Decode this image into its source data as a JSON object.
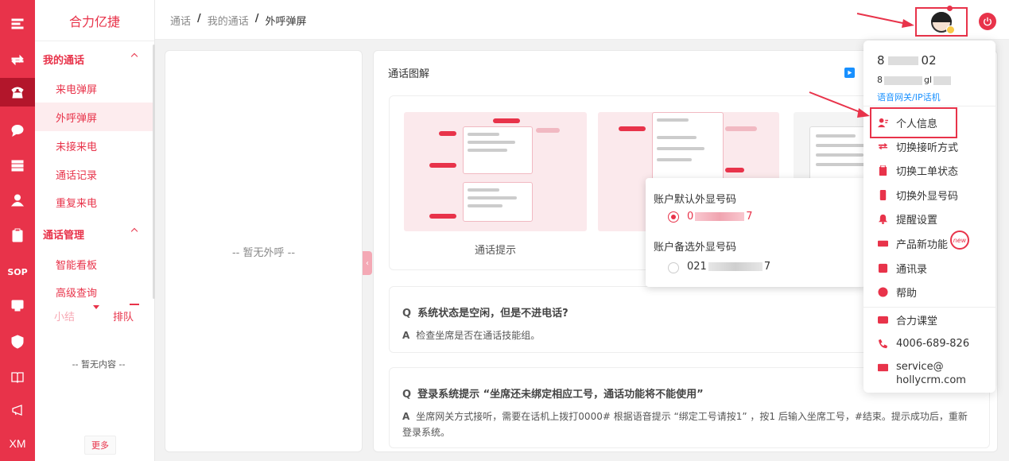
{
  "brand": "合力亿捷",
  "nav": {
    "group1": "我的通话",
    "items1": [
      "来电弹屏",
      "外呼弹屏",
      "未接来电",
      "通话记录",
      "重复来电"
    ],
    "group2": "通话管理",
    "items2": [
      "智能看板",
      "高级查询"
    ],
    "subtabs": [
      "小结",
      "排队"
    ],
    "empty": "-- 暂无内容 --",
    "more": "更多"
  },
  "rail": {
    "sop": "SOP",
    "xm": "XM"
  },
  "breadcrumb": [
    "通话",
    "我的通话",
    "外呼弹屏"
  ],
  "breadcrumb_sep": "/",
  "left_panel": {
    "empty": "-- 暂无外呼 --"
  },
  "main": {
    "title": "通话图解",
    "thumb_caption": "通话提示",
    "faq1": {
      "q_label": "Q",
      "q": "系统状态是空闲，但是不进电话?",
      "a_label": "A",
      "a": "检查坐席是否在通话技能组。"
    },
    "faq2": {
      "q_label": "Q",
      "q": "登录系统提示 “坐席还未绑定相应工号，通话功能将不能使用”",
      "a_label": "A",
      "a": "坐席网关方式接听，需要在话机上拨打0000# 根据语音提示 “绑定工号请按1” ，按1 后输入坐席工号，#结束。提示成功后，重新登录系统。"
    }
  },
  "popover": {
    "default_label": "账户默认外显号码",
    "default_num_prefix": "0",
    "default_num_suffix": "7",
    "backup_label": "账户备选外显号码",
    "backup_num_prefix": "021",
    "backup_num_suffix": "7"
  },
  "user_menu": {
    "name_prefix": "8",
    "name_suffix": "02",
    "account_prefix": "8",
    "account_suffix": "gl",
    "gateway": "语音网关/IP话机",
    "items": [
      "个人信息",
      "切换接听方式",
      "切换工单状态",
      "切换外显号码",
      "提醒设置",
      "产品新功能",
      "通讯录",
      "帮助"
    ],
    "new_badge": "new",
    "course": "合力课堂",
    "phone": "4006-689-826",
    "email_line1": "service@",
    "email_line2": "hollycrm.com"
  },
  "colors": {
    "accent": "#e8334a",
    "link": "#1890ff"
  }
}
